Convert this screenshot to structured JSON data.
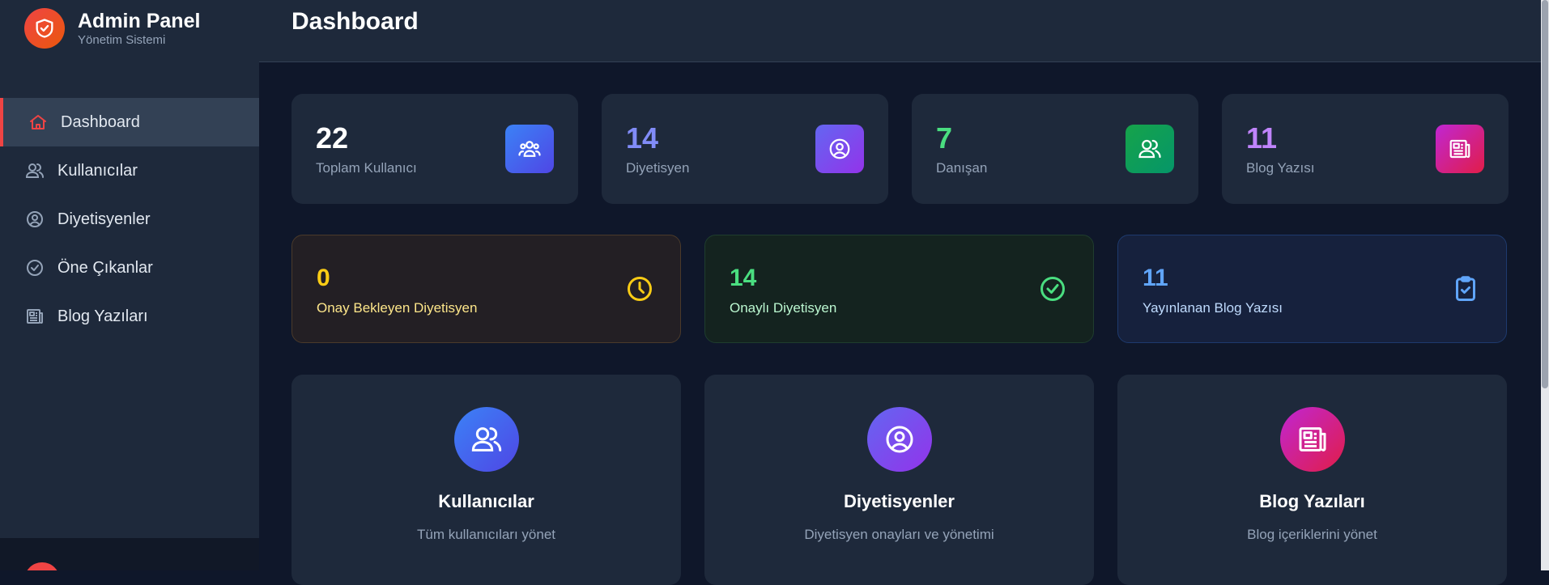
{
  "brand": {
    "title": "Admin Panel",
    "subtitle": "Yönetim Sistemi"
  },
  "sidebar": {
    "items": [
      {
        "label": "Dashboard",
        "icon": "home-icon",
        "active": true
      },
      {
        "label": "Kullanıcılar",
        "icon": "users-icon"
      },
      {
        "label": "Diyetisyenler",
        "icon": "user-circle-icon"
      },
      {
        "label": "Öne Çıkanlar",
        "icon": "check-circle-icon"
      },
      {
        "label": "Blog Yazıları",
        "icon": "newspaper-icon"
      }
    ]
  },
  "header": {
    "title": "Dashboard"
  },
  "stats": [
    {
      "value": "22",
      "label": "Toplam Kullanıcı",
      "icon": "user-group-icon",
      "color": "#ffffff"
    },
    {
      "value": "14",
      "label": "Diyetisyen",
      "icon": "user-circle-icon",
      "color": "#818cf8"
    },
    {
      "value": "7",
      "label": "Danışan",
      "icon": "users-icon",
      "color": "#4ade80"
    },
    {
      "value": "11",
      "label": "Blog Yazısı",
      "icon": "newspaper-icon",
      "color": "#c084fc"
    }
  ],
  "status_cards": [
    {
      "value": "0",
      "label": "Onay Bekleyen Diyetisyen",
      "icon": "clock-icon",
      "color": "#facc15"
    },
    {
      "value": "14",
      "label": "Onaylı Diyetisyen",
      "icon": "check-circle-icon",
      "color": "#4ade80"
    },
    {
      "value": "11",
      "label": "Yayınlanan Blog Yazısı",
      "icon": "clipboard-check-icon",
      "color": "#60a5fa"
    }
  ],
  "features": [
    {
      "title": "Kullanıcılar",
      "description": "Tüm kullanıcıları yönet",
      "icon": "users-icon"
    },
    {
      "title": "Diyetisyenler",
      "description": "Diyetisyen onayları ve yönetimi",
      "icon": "user-circle-icon"
    },
    {
      "title": "Blog Yazıları",
      "description": "Blog içeriklerini yönet",
      "icon": "newspaper-icon"
    }
  ]
}
